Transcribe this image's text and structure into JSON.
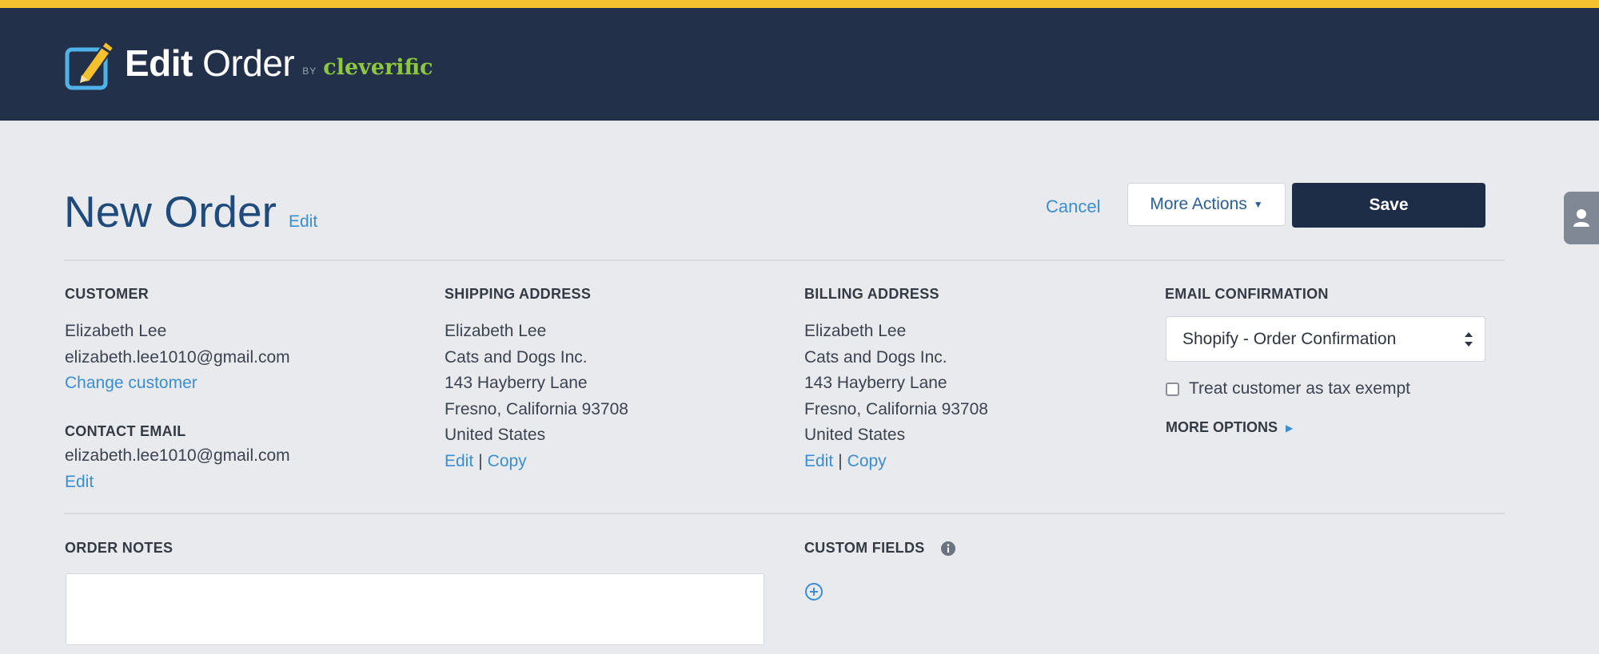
{
  "header": {
    "logo_bold": "Edit",
    "logo_regular": "Order",
    "logo_by": "BY",
    "logo_brand": "cleverific",
    "accent": "#f5c12e",
    "background": "#23304a"
  },
  "page": {
    "title": "New Order",
    "title_edit": "Edit"
  },
  "toolbar": {
    "cancel": "Cancel",
    "more_actions": "More Actions",
    "save": "Save"
  },
  "side_tab": {
    "icon": "user-icon"
  },
  "customer": {
    "label": "CUSTOMER",
    "name": "Elizabeth Lee",
    "email": "elizabeth.lee1010@gmail.com",
    "change": "Change customer"
  },
  "contact": {
    "label": "CONTACT EMAIL",
    "email": "elizabeth.lee1010@gmail.com",
    "edit": "Edit"
  },
  "shipping": {
    "label": "SHIPPING ADDRESS",
    "lines": [
      "Elizabeth Lee",
      "Cats and Dogs Inc.",
      "143 Hayberry Lane",
      "Fresno, California 93708",
      "United States"
    ],
    "edit": "Edit",
    "copy": "Copy"
  },
  "billing": {
    "label": "BILLING ADDRESS",
    "lines": [
      "Elizabeth Lee",
      "Cats and Dogs Inc.",
      "143 Hayberry Lane",
      "Fresno, California 93708",
      "United States"
    ],
    "edit": "Edit",
    "copy": "Copy"
  },
  "email_confirmation": {
    "label": "EMAIL CONFIRMATION",
    "selected": "Shopify - Order Confirmation",
    "tax_exempt": "Treat customer as tax exempt",
    "tax_exempt_checked": false,
    "more_options": "MORE OPTIONS"
  },
  "order_notes": {
    "label": "ORDER NOTES",
    "value": ""
  },
  "custom_fields": {
    "label": "CUSTOM FIELDS"
  }
}
